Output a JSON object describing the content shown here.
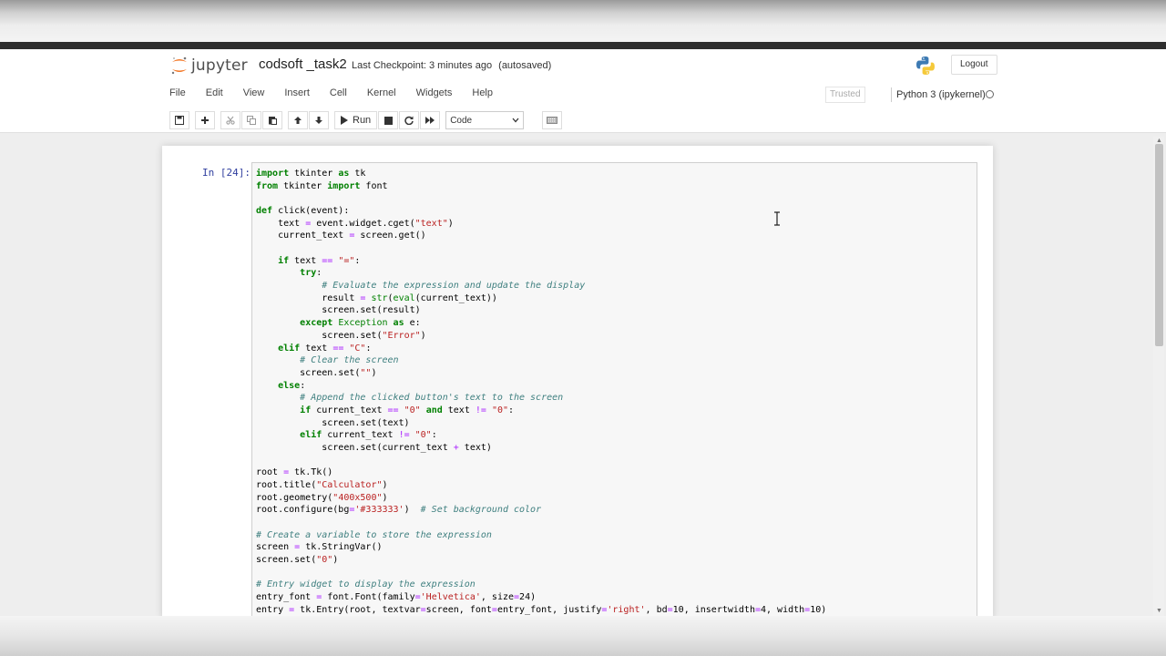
{
  "header": {
    "logo_text": "jupyter",
    "notebook_name": "codsoft _task2",
    "checkpoint": "Last Checkpoint: 3 minutes ago",
    "autosave": "(autosaved)",
    "logout": "Logout"
  },
  "menu": [
    "File",
    "Edit",
    "View",
    "Insert",
    "Cell",
    "Kernel",
    "Widgets",
    "Help"
  ],
  "status": {
    "trusted": "Trusted",
    "kernel": "Python 3 (ipykernel)"
  },
  "toolbar": {
    "run_label": "Run",
    "cell_type": "Code",
    "icons": [
      "save-icon",
      "add-cell-icon",
      "cut-icon",
      "copy-icon",
      "paste-icon",
      "move-up-icon",
      "move-down-icon",
      "run-icon",
      "stop-icon",
      "restart-icon",
      "fast-forward-icon",
      "keyboard-icon"
    ]
  },
  "cell": {
    "prompt": "In [24]:",
    "code": [
      "import tkinter as tk",
      "from tkinter import font",
      "",
      "def click(event):",
      "    text = event.widget.cget(\"text\")",
      "    current_text = screen.get()",
      "",
      "    if text == \"=\":",
      "        try:",
      "            # Evaluate the expression and update the display",
      "            result = str(eval(current_text))",
      "            screen.set(result)",
      "        except Exception as e:",
      "            screen.set(\"Error\")",
      "    elif text == \"C\":",
      "        # Clear the screen",
      "        screen.set(\"\")",
      "    else:",
      "        # Append the clicked button's text to the screen",
      "        if current_text == \"0\" and text != \"0\":",
      "            screen.set(text)",
      "        elif current_text != \"0\":",
      "            screen.set(current_text + text)",
      "",
      "root = tk.Tk()",
      "root.title(\"Calculator\")",
      "root.geometry(\"400x500\")",
      "root.configure(bg='#333333')  # Set background color",
      "",
      "# Create a variable to store the expression",
      "screen = tk.StringVar()",
      "screen.set(\"0\")",
      "",
      "# Entry widget to display the expression",
      "entry_font = font.Font(family='Helvetica', size=24)",
      "entry = tk.Entry(root, textvar=screen, font=entry_font, justify='right', bd=10, insertwidth=4, width=10)"
    ]
  },
  "colors": {
    "keyword": "#008000",
    "string": "#ba2121",
    "comment": "#408080",
    "prompt": "#303f9f",
    "jupyter_orange": "#f37726"
  }
}
